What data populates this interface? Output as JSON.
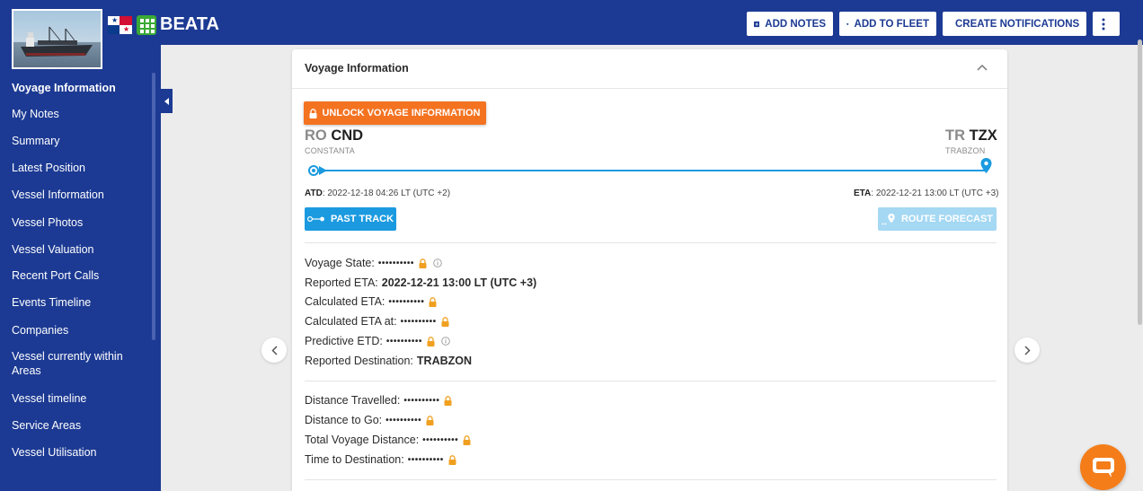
{
  "header": {
    "vessel_name": "BEATA",
    "flag": "Panama",
    "actions": {
      "add_notes": "ADD NOTES",
      "add_to_fleet": "ADD TO FLEET",
      "create_notifications": "CREATE NOTIFICATIONS"
    }
  },
  "sidebar": {
    "items": [
      "Voyage Information",
      "My Notes",
      "Summary",
      "Latest Position",
      "Vessel Information",
      "Vessel Photos",
      "Vessel Valuation",
      "Recent Port Calls",
      "Events Timeline",
      "Companies",
      "Vessel currently within Areas",
      "Vessel timeline",
      "Service Areas",
      "Vessel Utilisation"
    ],
    "active_index": 0
  },
  "card": {
    "title": "Voyage Information",
    "unlock_label": "UNLOCK VOYAGE INFORMATION",
    "origin": {
      "country": "RO",
      "code": "CND",
      "name": "CONSTANTA"
    },
    "destination": {
      "country": "TR",
      "code": "TZX",
      "name": "TRABZON"
    },
    "atd_label": "ATD",
    "atd_value": ": 2022-12-18 04:26 LT (UTC +2)",
    "eta_label": "ETA",
    "eta_value": ": 2022-12-21 13:00 LT (UTC +3)",
    "past_track_label": "PAST TRACK",
    "route_forecast_label": "ROUTE FORECAST",
    "masked_value": "••••••••••",
    "fields_1": [
      {
        "label": "Voyage State:",
        "locked": true,
        "info": true
      },
      {
        "label": "Reported ETA:",
        "value": "2022-12-21 13:00 LT (UTC +3)"
      },
      {
        "label": "Calculated ETA:",
        "locked": true
      },
      {
        "label": "Calculated ETA at:",
        "locked": true
      },
      {
        "label": "Predictive ETD:",
        "locked": true,
        "info": true
      },
      {
        "label": "Reported Destination:",
        "value": "TRABZON"
      }
    ],
    "fields_2": [
      {
        "label": "Distance Travelled:",
        "locked": true
      },
      {
        "label": "Distance to Go:",
        "locked": true
      },
      {
        "label": "Total Voyage Distance:",
        "locked": true
      },
      {
        "label": "Time to Destination:",
        "locked": true
      }
    ]
  },
  "colors": {
    "brand": "#1c3a93",
    "accent": "#1b9ae0",
    "unlock": "#f47321",
    "lock": "#f0a020"
  }
}
